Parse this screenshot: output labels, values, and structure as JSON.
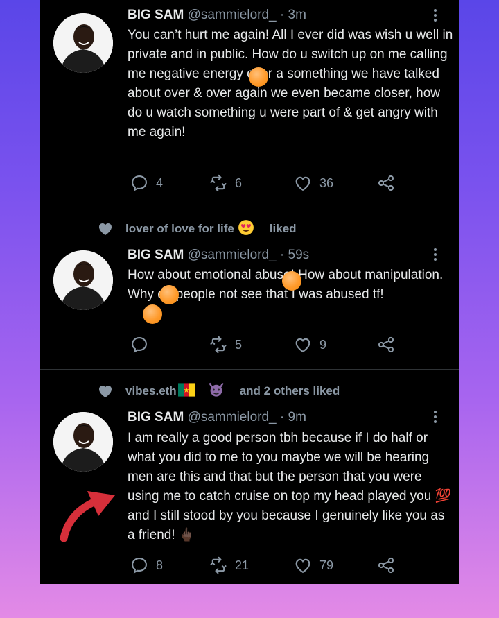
{
  "tweets": [
    {
      "name": "BIG SAM",
      "handle": "@sammielord_",
      "time": "· 3m",
      "text": "You can’t hurt me again! All I ever did was wish u well in private and in public. How do u switch up on me calling me negative energy over a something we have talked about over & over again we even became closer, how do u watch something u were part of & get angry with me again!",
      "replies": "4",
      "retweets": "6",
      "likes": "36"
    },
    {
      "liked_by": "lover of love for life",
      "liked_suffix": "liked",
      "name": "BIG SAM",
      "handle": "@sammielord_",
      "time": "· 59s",
      "text": "How about emotional abuse! How about manipulation. Why do people not see that I was abused tf!",
      "replies": "",
      "retweets": "5",
      "likes": "9"
    },
    {
      "liked_by": "vibes.eth",
      "liked_suffix": "and 2 others liked",
      "name": "BIG SAM",
      "handle": "@sammielord_",
      "time": "· 9m",
      "text": "I am really a good person tbh because if I do half or what you did to me to you maybe we will be hearing men are this and that but the person that you were using me to catch cruise on top my head played you 💯 and I still stood by you because I genuinely like you as a friend! 🖕🏿",
      "replies": "8",
      "retweets": "21",
      "likes": "79"
    }
  ],
  "colors": {
    "background_gradient": [
      "#5a46e8",
      "#e38ae6"
    ],
    "panel": "#000000",
    "text": "#e7e9ea",
    "muted": "#8b98a5",
    "arrow": "#d62f3a",
    "censor_dot": "#ff9a2a"
  },
  "icons": [
    "reply-icon",
    "retweet-icon",
    "like-icon",
    "share-icon",
    "more-icon",
    "heart-liked-icon"
  ]
}
